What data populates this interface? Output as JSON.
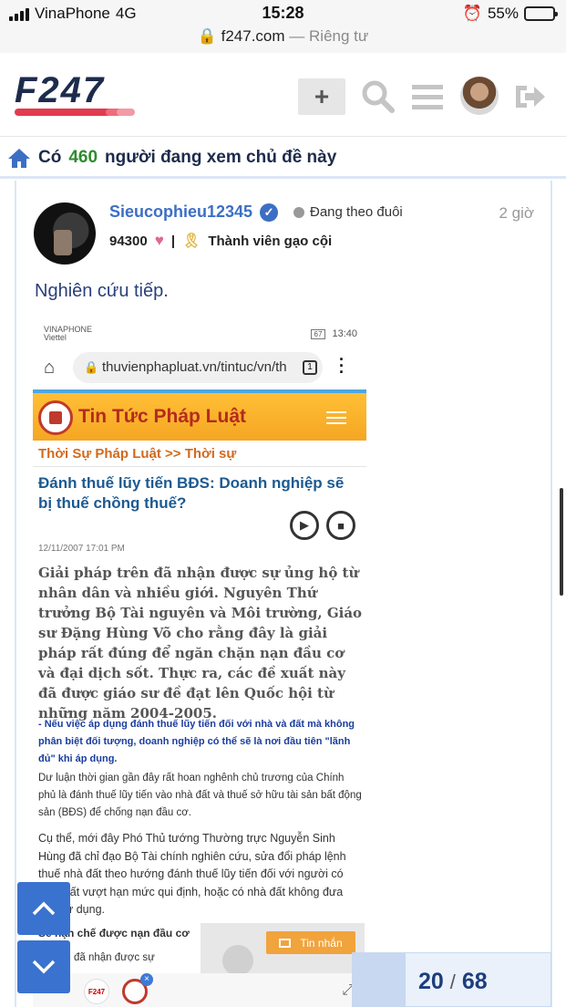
{
  "status_bar": {
    "carrier": "VinaPhone",
    "network": "4G",
    "time": "15:28",
    "battery_percent": "55%",
    "battery_level": 0.55
  },
  "browser": {
    "domain": "f247.com",
    "mode": "— Riêng tư"
  },
  "header": {
    "logo_text": "F247",
    "plus_label": "+",
    "icons": [
      "search-icon",
      "hamburger-menu-icon",
      "user-avatar",
      "logout-icon"
    ]
  },
  "viewers": {
    "prefix": "Có",
    "count": "460",
    "suffix": "người đang xem chủ đề này"
  },
  "post": {
    "username": "Sieucophieu12345",
    "follow_label": "Đang theo đuôi",
    "time": "2 giờ",
    "score": "94300",
    "separator": "|",
    "rank": "Thành viên gạo cội",
    "text": "Nghiên cứu tiếp."
  },
  "embedded_screenshot": {
    "carrier_line1": "VINAPHONE",
    "carrier_line2": "Viettel",
    "battery": "67",
    "time": "13:40",
    "url": "thuvienphapluat.vn/tintuc/vn/th",
    "tab_count": "1",
    "site_title": "Tin Tức Pháp Luật",
    "breadcrumb": "Thời Sự Pháp Luật >> Thời sự",
    "headline": "Đánh thuế lũy tiến BĐS: Doanh nghiệp sẽ bị thuế chồng thuế?",
    "date": "12/11/2007 17:01 PM",
    "lead": "Giải pháp trên đã nhận được sự ủng hộ từ nhân dân và nhiều giới. Nguyên Thứ trưởng Bộ Tài nguyên và Môi trường, Giáo sư Đặng Hùng Võ cho rằng đây là giải pháp rất đúng để ngăn chặn nạn đầu cơ và đại dịch sốt. Thực ra, các đề xuất này đã được giáo sư đề đạt lên Quốc hội từ những năm 2004-2005.",
    "quote": "- Nếu việc áp dụng đánh thuế lũy tiến đối với nhà và đất mà không phân biệt đối tượng, doanh nghiệp có thể sẽ là nơi đầu tiên \"lãnh đủ\" khi áp dụng.",
    "paragraph1": "Dư luận thời gian gần đây rất hoan nghênh chủ trương của Chính phủ là đánh thuế lũy tiến vào nhà đất và thuế sở hữu tài sản bất động sản (BĐS) để chống nạn đầu cơ.",
    "paragraph2": " Cụ thể, mới đây Phó Thủ tướng Thường trực Nguyễn Sinh Hùng đã chỉ đạo Bộ Tài chính nghiên cứu, sửa đổi pháp lệnh thuế nhà đất theo hướng đánh thuế lũy tiến đối với người có nhà, đất vượt hạn mức qui định, hoặc có nhà đất không đưa vào sử dụng.",
    "subheading": "Sẽ hạn chế được nạn đầu cơ",
    "paragraph3": "áp trên đã nhận được sự",
    "chat_label": "Tin nhắn",
    "bottom_logo": "F247",
    "badge": "×"
  },
  "pager": {
    "current": "20",
    "separator": "/",
    "total": "68"
  },
  "colors": {
    "accent_blue": "#3c6fc4",
    "logo_navy": "#1d2b4c",
    "logo_red": "#e23b4e",
    "viewer_green": "#2e8b2e"
  }
}
